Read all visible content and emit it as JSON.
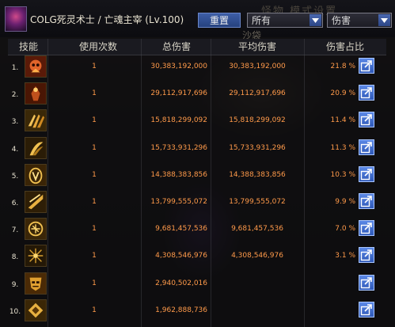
{
  "header": {
    "character": "COLG死灵术士 / 亡魂主宰 (Lv.100)",
    "reset_label": "重置",
    "target_select": "所有",
    "type_select": "伤害",
    "background_title": "怪物 模式设置",
    "background_label": "沙袋"
  },
  "table": {
    "columns": [
      "技能",
      "使用次数",
      "总伤害",
      "平均伤害",
      "伤害占比"
    ],
    "rows": [
      {
        "rank": "1.",
        "icon": "skill-icon-flame-skull",
        "count": "1",
        "total": "30,383,192,000",
        "avg": "30,383,192,000",
        "pct": "21.8 %"
      },
      {
        "rank": "2.",
        "icon": "skill-icon-dark-figure",
        "count": "1",
        "total": "29,112,917,696",
        "avg": "29,112,917,696",
        "pct": "20.9 %"
      },
      {
        "rank": "3.",
        "icon": "skill-icon-claw-strike",
        "count": "1",
        "total": "15,818,299,092",
        "avg": "15,818,299,092",
        "pct": "11.4 %"
      },
      {
        "rank": "4.",
        "icon": "skill-icon-claw-slash",
        "count": "1",
        "total": "15,733,931,296",
        "avg": "15,733,931,296",
        "pct": "11.3 %"
      },
      {
        "rank": "5.",
        "icon": "skill-icon-spirit-hand",
        "count": "1",
        "total": "14,388,383,856",
        "avg": "14,388,383,856",
        "pct": "10.3 %"
      },
      {
        "rank": "6.",
        "icon": "skill-icon-wing-fan",
        "count": "1",
        "total": "13,799,555,072",
        "avg": "13,799,555,072",
        "pct": "9.9 %"
      },
      {
        "rank": "7.",
        "icon": "skill-icon-rune-circle",
        "count": "1",
        "total": "9,681,457,536",
        "avg": "9,681,457,536",
        "pct": "7.0 %"
      },
      {
        "rank": "8.",
        "icon": "skill-icon-shatter",
        "count": "1",
        "total": "4,308,546,976",
        "avg": "4,308,546,976",
        "pct": "3.1 %"
      },
      {
        "rank": "9.",
        "icon": "skill-icon-demon-mask",
        "count": "1",
        "total": "2,940,502,016",
        "avg": "",
        "pct": ""
      },
      {
        "rank": "10.",
        "icon": "skill-icon-gold-sigil",
        "count": "1",
        "total": "1,962,888,736",
        "avg": "",
        "pct": ""
      }
    ]
  },
  "colors": {
    "accent_text": "#ff9a4a",
    "button_blue": "#3d5ea6"
  }
}
